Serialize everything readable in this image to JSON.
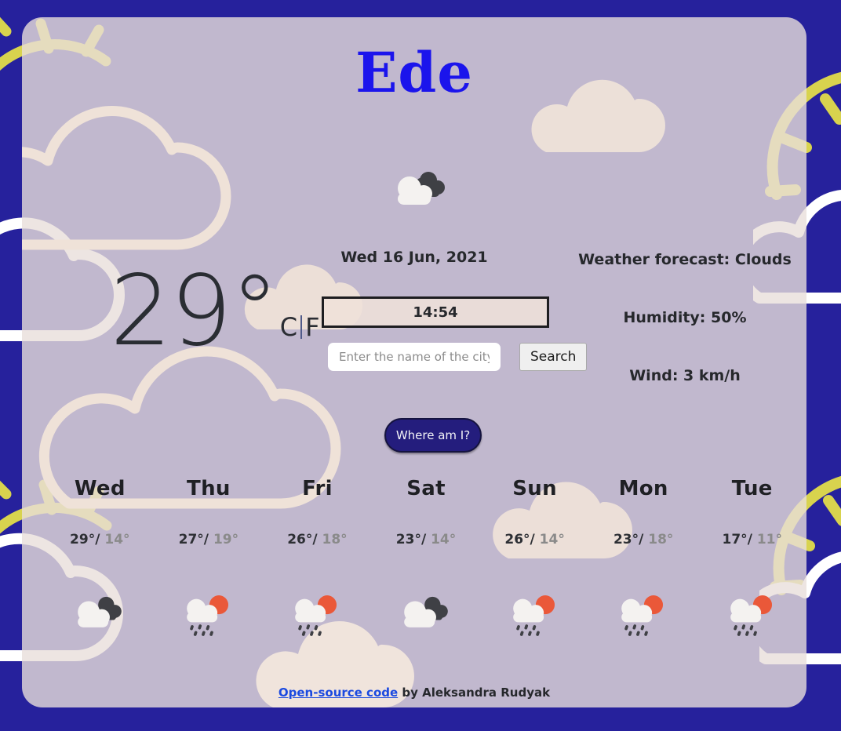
{
  "app": {
    "city": "Ede",
    "current_icon": "clouds-icon",
    "date": "Wed 16 Jun, 2021",
    "time": "14:54",
    "temperature": "29",
    "degree_symbol": "°",
    "unit_celsius": "C",
    "unit_separator": "|",
    "unit_fahrenheit": "F"
  },
  "search": {
    "placeholder": "Enter the name of the city",
    "value": "",
    "button_label": "Search"
  },
  "geolocation": {
    "button_label": "Where am I?"
  },
  "stats": {
    "forecast": "Weather forecast: Clouds",
    "humidity": "Humidity: 50%",
    "wind": "Wind: 3 km/h"
  },
  "forecast": {
    "days": [
      {
        "day": "Wed",
        "high": "29°",
        "sep": "/",
        "low": "14°",
        "icon": "clouds-icon"
      },
      {
        "day": "Thu",
        "high": "27°",
        "sep": "/",
        "low": "19°",
        "icon": "rain-sun-icon"
      },
      {
        "day": "Fri",
        "high": "26°",
        "sep": "/",
        "low": "18°",
        "icon": "rain-sun-icon"
      },
      {
        "day": "Sat",
        "high": "23°",
        "sep": "/",
        "low": "14°",
        "icon": "clouds-icon"
      },
      {
        "day": "Sun",
        "high": "26°",
        "sep": "/",
        "low": "14°",
        "icon": "rain-sun-icon"
      },
      {
        "day": "Mon",
        "high": "23°",
        "sep": "/",
        "low": "18°",
        "icon": "rain-sun-icon"
      },
      {
        "day": "Tue",
        "high": "17°",
        "sep": "/",
        "low": "11°",
        "icon": "rain-sun-icon"
      }
    ]
  },
  "footer": {
    "link_label": "Open-source code",
    "credit": " by Aleksandra Rudyak"
  },
  "colors": {
    "background": "#26219c",
    "card": "#e9dedb",
    "title": "#1b14ec",
    "accent_button": "#241d7d",
    "link": "#1b4ae0",
    "sun": "#ea5839",
    "cloud_dark": "#3f4045",
    "cloud_light": "#f4f2f0",
    "deco_cream": "#efe3da",
    "deco_yellow": "#ece36a"
  }
}
